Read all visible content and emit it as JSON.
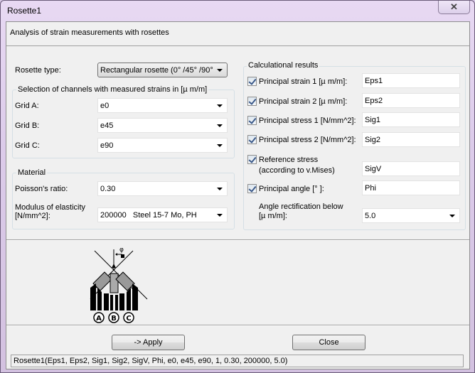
{
  "window": {
    "title": "Rosette1",
    "close_glyph": "✕"
  },
  "header": {
    "description": "Analysis of strain measurements with rosettes"
  },
  "rosette": {
    "type_label": "Rosette type:",
    "type_value": "Rectangular rosette (0° /45° /90°"
  },
  "channels": {
    "group_title": "Selection of channels with measured strains in [µ m/m]",
    "grids": [
      {
        "label": "Grid A:",
        "value": "e0"
      },
      {
        "label": "Grid B:",
        "value": "e45"
      },
      {
        "label": "Grid C:",
        "value": "e90"
      }
    ]
  },
  "material": {
    "group_title": "Material",
    "poisson_label": "Poisson's ratio:",
    "poisson_value": "0.30",
    "modulus_label_line1": "Modulus of elasticity",
    "modulus_label_line2": "[N/mm^2]:",
    "modulus_value": "200000   Steel 15-7 Mo, PH"
  },
  "results": {
    "group_title": "Calculational results",
    "items": [
      {
        "label": "Principal strain 1 [µ m/m]:",
        "value": "Eps1",
        "checked": true
      },
      {
        "label": "Principal strain 2 [µ m/m]:",
        "value": "Eps2",
        "checked": true
      },
      {
        "label": "Principal stress 1 [N/mm^2]:",
        "value": "Sig1",
        "checked": true
      },
      {
        "label": "Principal stress 2 [N/mm^2]:",
        "value": "Sig2",
        "checked": true
      }
    ],
    "reference": {
      "label_line1": "Reference stress",
      "label_line2": "(according to v.Mises)",
      "value": "SigV",
      "checked": true
    },
    "angle": {
      "label": "Principal angle [° ]:",
      "value": "Phi",
      "checked": true
    },
    "rectification": {
      "label_line1": "Angle rectification below",
      "label_line2": "[µ m/m]:",
      "value": "5.0"
    }
  },
  "diagram": {
    "grid_labels": [
      "A",
      "B",
      "C"
    ],
    "angle_symbol": "φ"
  },
  "buttons": {
    "apply": "-> Apply",
    "close": "Close"
  },
  "status": {
    "formula": "Rosette1(Eps1, Eps2, Sig1, Sig2, SigV, Phi, e0, e45, e90, 1, 0.30, 200000, 5.0)"
  }
}
